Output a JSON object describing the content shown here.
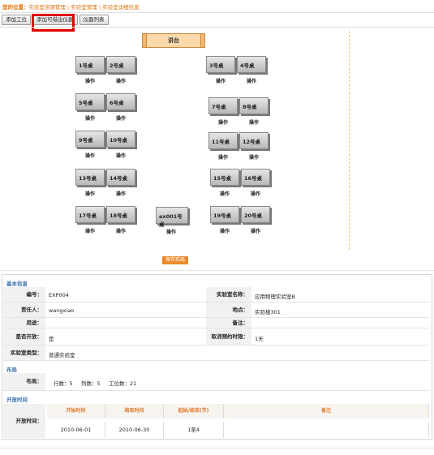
{
  "breadcrumb": {
    "label": "您的位置：",
    "path": "实验室资源管理 \\ 实验室管理 \\ 实验室详细信息"
  },
  "toolbar": {
    "add_station": "添加工位",
    "add_lendable": "添加可借出仪器",
    "instrument_list": "仪器列表"
  },
  "podium": "讲台",
  "desks": [
    {
      "name": "1号桌",
      "op": "操作"
    },
    {
      "name": "2号桌",
      "op": "操作"
    },
    {
      "name": "3号桌",
      "op": "操作"
    },
    {
      "name": "4号桌",
      "op": "操作"
    },
    {
      "name": "5号桌",
      "op": "操作"
    },
    {
      "name": "6号桌",
      "op": "操作"
    },
    {
      "name": "7号桌",
      "op": "操作"
    },
    {
      "name": "8号桌",
      "op": "操作"
    },
    {
      "name": "9号桌",
      "op": "操作"
    },
    {
      "name": "10号桌",
      "op": "操作"
    },
    {
      "name": "11号桌",
      "op": "操作"
    },
    {
      "name": "12号桌",
      "op": "操作"
    },
    {
      "name": "13号桌",
      "op": "操作"
    },
    {
      "name": "14号桌",
      "op": "操作"
    },
    {
      "name": "15号桌",
      "op": "操作"
    },
    {
      "name": "16号桌",
      "op": "操作"
    },
    {
      "name": "17号桌",
      "op": "操作"
    },
    {
      "name": "18号桌",
      "op": "操作"
    },
    {
      "name": "ex001号桌",
      "op": "操作"
    },
    {
      "name": "19号桌",
      "op": "操作"
    },
    {
      "name": "20号桌",
      "op": "操作"
    }
  ],
  "save_button": "保存布局",
  "basic": {
    "title": "基本信息",
    "code_label": "编号：",
    "code": "EXP004",
    "name_label": "实验室名称：",
    "name": "应用物理实验室B",
    "owner_label": "责任人：",
    "owner": "wangxiao",
    "location_label": "地点：",
    "location": "实验楼301",
    "usage_label": "用途：",
    "usage": "",
    "remark_label": "备注：",
    "remark": "",
    "open_label": "是否开放：",
    "open": "是",
    "cancel_label": "取消预约时限：",
    "cancel": "1天",
    "type_label": "实验室类型：",
    "type": "普通实验室"
  },
  "layout": {
    "title": "布局",
    "label": "布局：",
    "rows_label": "行数：",
    "rows": "5",
    "cols_label": "列数：",
    "cols": "5",
    "stations_label": "工位数：",
    "stations": "21"
  },
  "open_time": {
    "title": "开放时间",
    "label": "开放时间：",
    "headers": [
      "开始时间",
      "结束时间",
      "起始/结束(节)",
      "备注"
    ],
    "row": [
      "2010-06-01",
      "2010-06-30",
      "1至4",
      ""
    ]
  }
}
